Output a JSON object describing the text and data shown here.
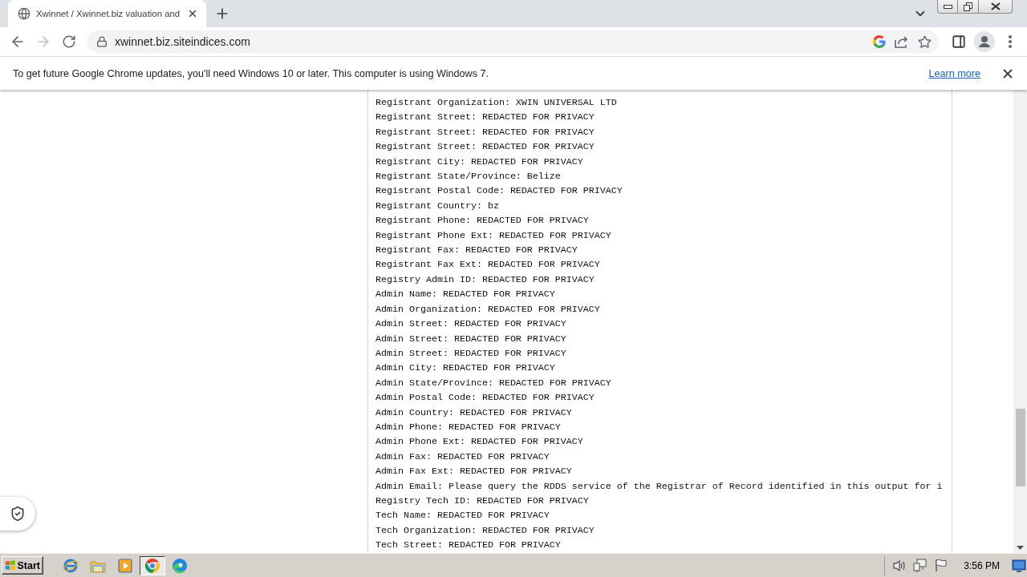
{
  "browser": {
    "tabs": [
      {
        "title": "Xwinnet / Xwinnet.biz valuation and",
        "selected": true
      }
    ],
    "nav_buttons": [
      {
        "kind": "back",
        "disabled": false
      },
      {
        "kind": "forward",
        "disabled": true
      },
      {
        "kind": "reload",
        "disabled": false
      }
    ],
    "address": "xwinnet.biz.siteindices.com"
  },
  "infobar": {
    "message": "To get future Google Chrome updates, you'll need Windows 10 or later. This computer is using Windows 7.",
    "link": "Learn more"
  },
  "whois_lines": [
    "Registrant Organization: XWIN UNIVERSAL LTD",
    "Registrant Street: REDACTED FOR PRIVACY",
    "Registrant Street: REDACTED FOR PRIVACY",
    "Registrant Street: REDACTED FOR PRIVACY",
    "Registrant City: REDACTED FOR PRIVACY",
    "Registrant State/Province: Belize",
    "Registrant Postal Code: REDACTED FOR PRIVACY",
    "Registrant Country: bz",
    "Registrant Phone: REDACTED FOR PRIVACY",
    "Registrant Phone Ext: REDACTED FOR PRIVACY",
    "Registrant Fax: REDACTED FOR PRIVACY",
    "Registrant Fax Ext: REDACTED FOR PRIVACY",
    "Registry Admin ID: REDACTED FOR PRIVACY",
    "Admin Name: REDACTED FOR PRIVACY",
    "Admin Organization: REDACTED FOR PRIVACY",
    "Admin Street: REDACTED FOR PRIVACY",
    "Admin Street: REDACTED FOR PRIVACY",
    "Admin Street: REDACTED FOR PRIVACY",
    "Admin City: REDACTED FOR PRIVACY",
    "Admin State/Province: REDACTED FOR PRIVACY",
    "Admin Postal Code: REDACTED FOR PRIVACY",
    "Admin Country: REDACTED FOR PRIVACY",
    "Admin Phone: REDACTED FOR PRIVACY",
    "Admin Phone Ext: REDACTED FOR PRIVACY",
    "Admin Fax: REDACTED FOR PRIVACY",
    "Admin Fax Ext: REDACTED FOR PRIVACY",
    "Admin Email: Please query the RDDS service of the Registrar of Record identified in this output for i",
    "Registry Tech ID: REDACTED FOR PRIVACY",
    "Tech Name: REDACTED FOR PRIVACY",
    "Tech Organization: REDACTED FOR PRIVACY",
    "Tech Street: REDACTED FOR PRIVACY"
  ],
  "taskbar": {
    "start": "Start",
    "apps": [
      {
        "kind": "ie",
        "selected": false
      },
      {
        "kind": "explorer",
        "selected": false
      },
      {
        "kind": "media",
        "selected": false
      },
      {
        "kind": "chrome",
        "selected": true
      },
      {
        "kind": "edge",
        "selected": false
      }
    ],
    "clock": "3:56 PM"
  }
}
